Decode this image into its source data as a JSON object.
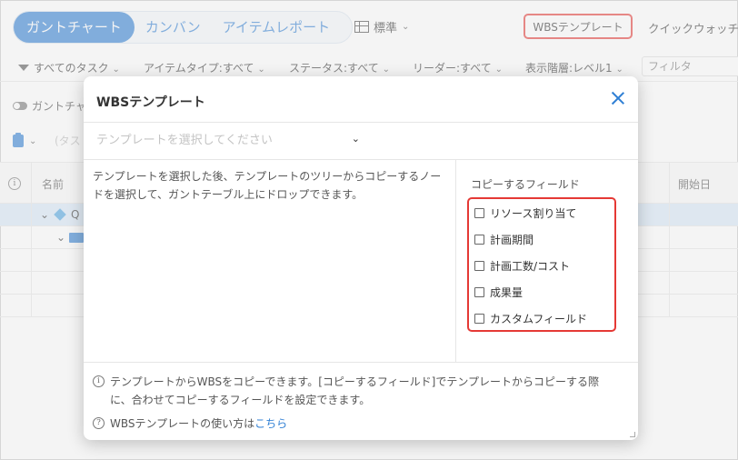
{
  "top_tabs": [
    {
      "label": "ガントチャート",
      "active": true
    },
    {
      "label": "カンバン",
      "active": false
    },
    {
      "label": "アイテムレポート",
      "active": false
    }
  ],
  "view_selector": {
    "label": "標準",
    "icon": "grid-icon"
  },
  "wbs_button": {
    "label": "WBSテンプレート"
  },
  "quick_button": {
    "label": "クイックウォッチ"
  },
  "filters": {
    "all_tasks": "すべてのタスク",
    "item_type": "アイテムタイプ:すべて",
    "status": "ステータス:すべて",
    "leader": "リーダー:すべて",
    "level": "表示階層:レベル1",
    "search_placeholder": "フィルタ"
  },
  "background": {
    "gantt_toggle": "ガントチャ",
    "input_hint": "(タス",
    "table_headers": {
      "name": "名前",
      "start": "開始日"
    },
    "row1_text": "Q"
  },
  "modal": {
    "title": "WBSテンプレート",
    "select_placeholder": "テンプレートを選択してください",
    "description": "テンプレートを選択した後、テンプレートのツリーからコピーするノードを選択して、ガントテーブル上にドロップできます。",
    "copy_fields_label": "コピーするフィールド",
    "fields": [
      {
        "label": "リソース割り当て",
        "checked": false
      },
      {
        "label": "計画期間",
        "checked": false
      },
      {
        "label": "計画工数/コスト",
        "checked": false
      },
      {
        "label": "成果量",
        "checked": false
      },
      {
        "label": "カスタムフィールド",
        "checked": false
      }
    ],
    "info_text": "テンプレートからWBSをコピーできます。[コピーするフィールド]でテンプレートからコピーする際に、合わせてコピーするフィールドを設定できます。",
    "help_text": "WBSテンプレートの使い方は",
    "help_link": "こちら"
  },
  "colors": {
    "accent": "#2f7fd4",
    "highlight": "#e53935"
  }
}
